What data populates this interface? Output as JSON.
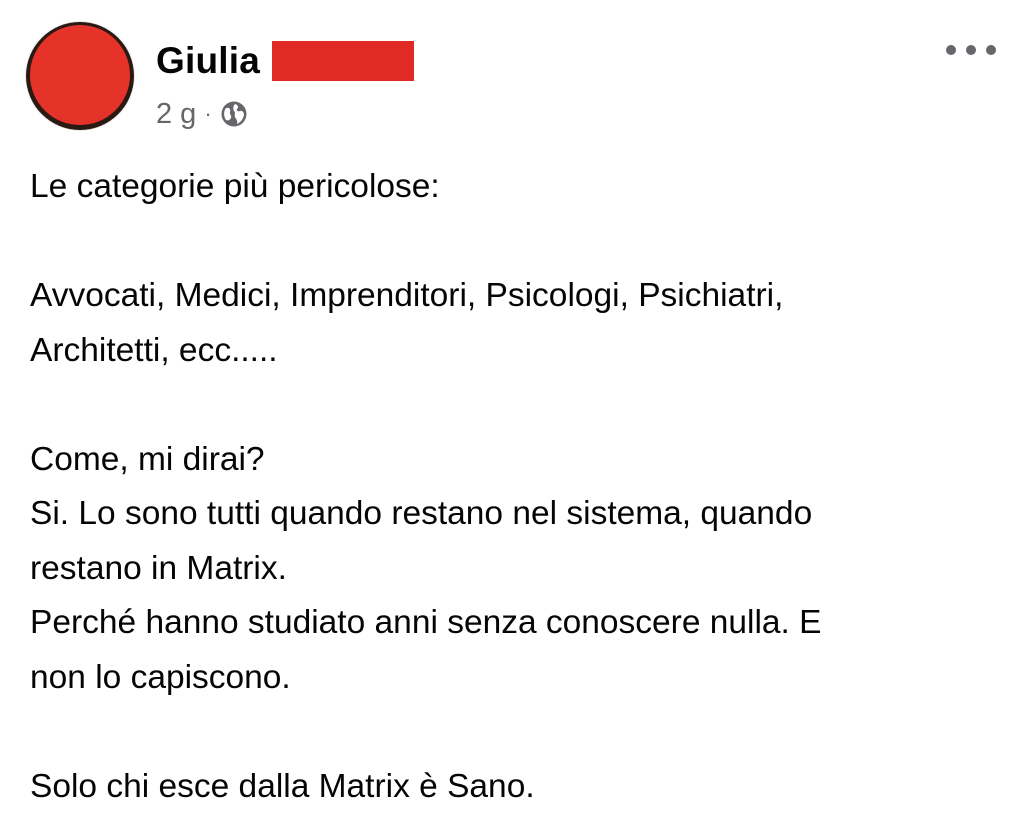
{
  "post": {
    "author": {
      "name": "Giulia",
      "avatar": "avatar-icon",
      "avatar_color": "#e5332a",
      "redaction_color": "#e02a24"
    },
    "meta": {
      "time": "2 g",
      "separator": "·",
      "audience_icon": "globe-icon"
    },
    "menu_icon": "more-options-icon",
    "body": {
      "line1": "Le categorie più pericolose:",
      "line2": "Avvocati, Medici, Imprenditori, Psicologi, Psichiatri,\nArchitetti, ecc.....",
      "line3": "Come, mi dirai?\nSi. Lo sono tutti quando restano nel sistema, quando\nrestano in Matrix.\nPerché hanno studiato anni senza conoscere nulla. E\nnon lo capiscono.",
      "line4": "Solo chi esce dalla Matrix è Sano."
    }
  }
}
